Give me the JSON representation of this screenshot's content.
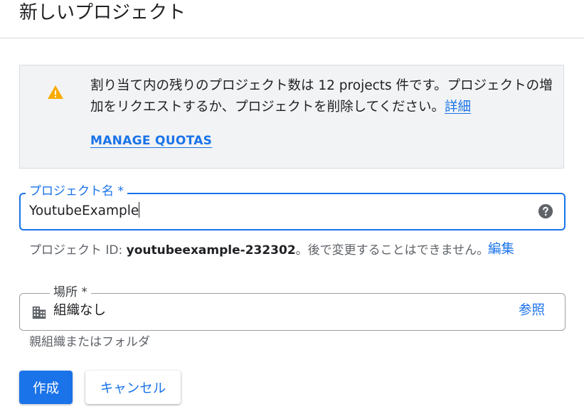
{
  "header": {
    "title": "新しいプロジェクト"
  },
  "alert": {
    "icon": "warning-icon",
    "icon_color": "#f9ab00",
    "text": "割り当て内の残りのプロジェクト数は 12 projects 件です。プロジェクトの増加をリクエストするか、プロジェクトを削除してください。",
    "learn_more": "詳細",
    "manage_quotas": "MANAGE QUOTAS"
  },
  "project_name": {
    "label": "プロジェクト名 *",
    "value": "YoutubeExample",
    "help_icon": "help-icon"
  },
  "project_id": {
    "prefix": "プロジェクト ID: ",
    "value": "youtubeexample-232302",
    "suffix": "。後で変更することはできません。",
    "edit": "編集"
  },
  "location": {
    "label": "場所 *",
    "icon": "building-icon",
    "value": "組織なし",
    "browse": "参照",
    "hint": "親組織またはフォルダ"
  },
  "actions": {
    "create": "作成",
    "cancel": "キャンセル"
  },
  "colors": {
    "accent": "#1a73e8",
    "alert_bg": "#f1f3f4",
    "text": "#202124",
    "muted": "#5f6368"
  }
}
